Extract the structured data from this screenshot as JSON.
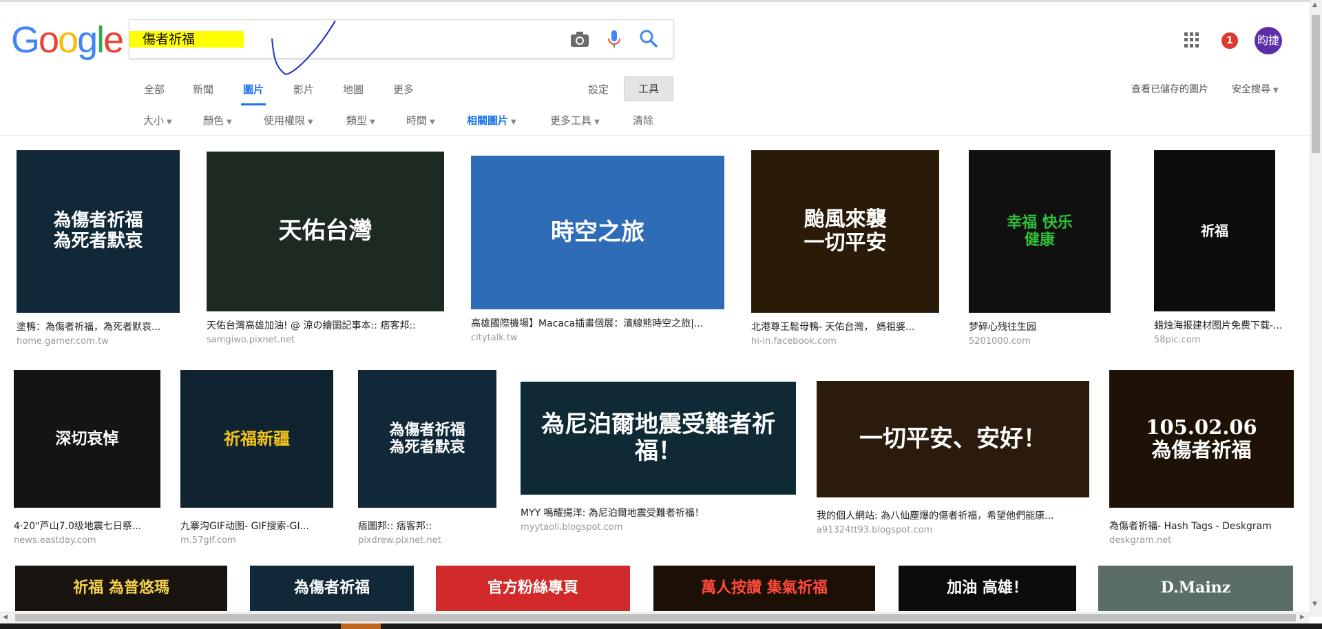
{
  "header": {
    "logo": "Google",
    "query": "傷者祈福",
    "user_initials": "昀捷",
    "notification_count": "1"
  },
  "tabs": [
    {
      "label": "全部",
      "active": false
    },
    {
      "label": "新聞",
      "active": false
    },
    {
      "label": "圖片",
      "active": true
    },
    {
      "label": "影片",
      "active": false
    },
    {
      "label": "地圖",
      "active": false
    },
    {
      "label": "更多",
      "active": false
    }
  ],
  "settings_label": "設定",
  "tools_label": "工具",
  "saved_images_label": "查看已儲存的圖片",
  "safesearch_label": "安全搜尋",
  "tools": [
    {
      "label": "大小",
      "active": false,
      "dropdown": true
    },
    {
      "label": "顏色",
      "active": false,
      "dropdown": true
    },
    {
      "label": "使用權限",
      "active": false,
      "dropdown": true
    },
    {
      "label": "類型",
      "active": false,
      "dropdown": true
    },
    {
      "label": "時間",
      "active": false,
      "dropdown": true
    },
    {
      "label": "相關圖片",
      "active": true,
      "dropdown": true
    },
    {
      "label": "更多工具",
      "active": false,
      "dropdown": true
    },
    {
      "label": "清除",
      "active": false,
      "dropdown": false
    }
  ],
  "results": [
    {
      "title": "塗鴨：為傷者祈福，為死者默哀...",
      "site": "home.gamer.com.tw",
      "image_text": "為傷者祈福\n為死者默哀",
      "bg": "#102838",
      "fg": "#ffffff"
    },
    {
      "title": "天佑台灣高雄加油! @ 涼の繪圖記事本:: 痞客邦::",
      "site": "samgiwo.pixnet.net",
      "image_text": "天佑台灣",
      "bg": "#1c2a22",
      "fg": "#ffffff"
    },
    {
      "title": "高雄國際機場】Macaca插畫個展：濱線熊時空之旅|...",
      "site": "citytalk.tw",
      "image_text": "時空之旅",
      "bg": "#2f6cb8",
      "fg": "#ffffff"
    },
    {
      "title": "北港尊王鬆母鴨- 天佑台灣， 媽祖婆...",
      "site": "hi-in.facebook.com",
      "image_text": "颱風來襲\n一切平安",
      "bg": "#2a1a08",
      "fg": "#ffffff"
    },
    {
      "title": "梦碎心残往生园",
      "site": "5201000.com",
      "image_text": "幸福 快乐\n健康",
      "bg": "#101010",
      "fg": "#2fbf3a"
    },
    {
      "title": "蜡烛海报建材图片免费下载-...",
      "site": "58pic.com",
      "image_text": "祈福",
      "bg": "#0c0c0c",
      "fg": "#ffffff"
    },
    {
      "title": "4·20\"芦山7.0级地震七日祭...",
      "site": "news.eastday.com",
      "image_text": "深切哀悼",
      "bg": "#141414",
      "fg": "#ffffff"
    },
    {
      "title": "九寨沟GIF动图- GIF搜索-GI...",
      "site": "m.57gif.com",
      "image_text": "祈福新疆",
      "bg": "#0f2430",
      "fg": "#f2c21b"
    },
    {
      "title": "痞圖邦:: 痞客邦::",
      "site": "pixdrew.pixnet.net",
      "image_text": "為傷者祈福\n為死者默哀",
      "bg": "#102838",
      "fg": "#ffffff"
    },
    {
      "title": "MYY 鳴耀揚洋: 為尼泊爾地震受難者祈福！",
      "site": "myytaoli.blogspot.com",
      "image_text": "為尼泊爾地震受難者祈福！",
      "bg": "#0f2a35",
      "fg": "#ffffff"
    },
    {
      "title": "我的個人網站: 為八仙塵爆的傷者祈福，希望他們能康...",
      "site": "a91324tt93.blogspot.com",
      "image_text": "一切平安、安好！",
      "bg": "#2a1b0c",
      "fg": "#ffffff"
    },
    {
      "title": "為傷者祈福- Hash Tags - Deskgram",
      "site": "deskgram.net",
      "image_text": "105.02.06\n為傷者祈福",
      "bg": "#1e1206",
      "fg": "#ffffff"
    },
    {
      "title": "",
      "site": "",
      "image_text": "祈福 為普悠瑪",
      "bg": "#1a1410",
      "fg": "#f4d24a"
    },
    {
      "title": "",
      "site": "",
      "image_text": "為傷者祈福",
      "bg": "#102838",
      "fg": "#ffffff"
    },
    {
      "title": "",
      "site": "",
      "image_text": "官方粉絲專頁",
      "bg": "#d22a2a",
      "fg": "#ffffff"
    },
    {
      "title": "",
      "site": "",
      "image_text": "萬人按讚 集氣祈福",
      "bg": "#1c0f06",
      "fg": "#ff4a3a"
    },
    {
      "title": "",
      "site": "",
      "image_text": "加油 高雄！",
      "bg": "#0c0c0c",
      "fg": "#ffffff"
    },
    {
      "title": "",
      "site": "",
      "image_text": "D.Mainz",
      "bg": "#5a6e66",
      "fg": "#ffffff"
    }
  ]
}
